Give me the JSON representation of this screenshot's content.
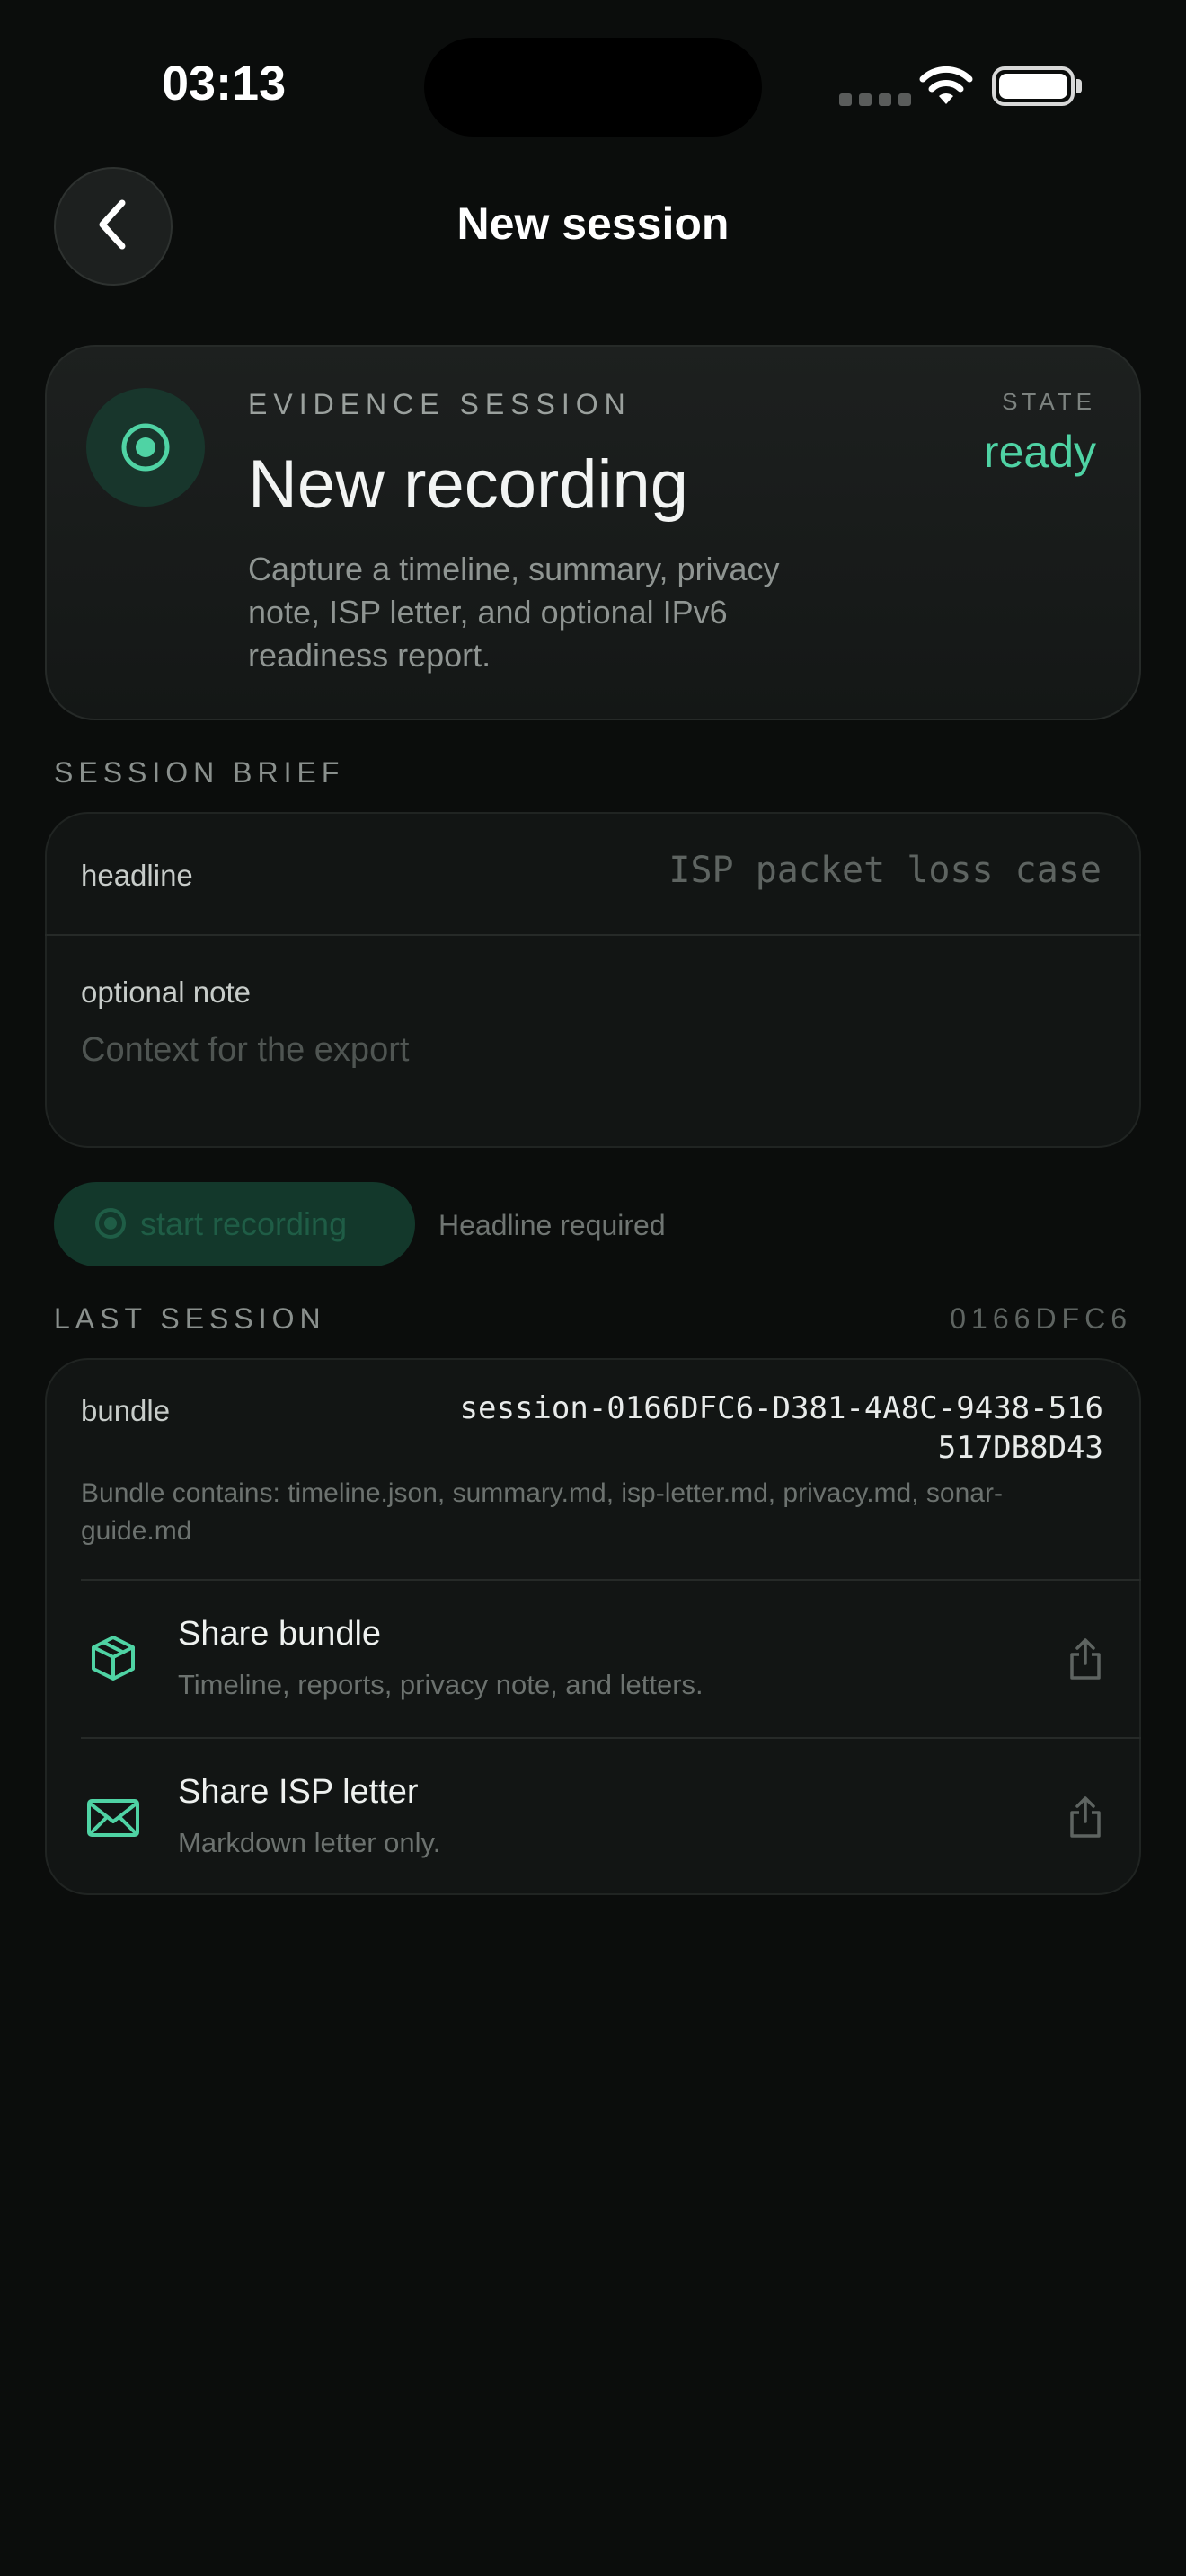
{
  "status_bar": {
    "time": "03:13"
  },
  "nav": {
    "title": "New session"
  },
  "hero": {
    "eyebrow": "EVIDENCE SESSION",
    "title": "New recording",
    "description": "Capture a timeline, summary, privacy note, ISP letter, and optional IPv6 readiness report.",
    "state_label": "STATE",
    "state_value": "ready"
  },
  "brief": {
    "section_title": "SESSION BRIEF",
    "headline_label": "headline",
    "headline_value": "",
    "headline_placeholder": "ISP packet loss case",
    "note_label": "optional note",
    "note_value": "",
    "note_placeholder": "Context for the export"
  },
  "record": {
    "button_label": "start recording",
    "hint": "Headline required"
  },
  "last_session": {
    "section_title": "LAST SESSION",
    "short_id": "0166DFC6",
    "bundle_label": "bundle",
    "bundle_id": "session-0166DFC6-D381-4A8C-9438-516517DB8D43",
    "bundle_contents": "Bundle contains: timeline.json, summary.md, isp-letter.md, privacy.md, sonar-guide.md",
    "actions": [
      {
        "title": "Share bundle",
        "subtitle": "Timeline, reports, privacy note, and letters."
      },
      {
        "title": "Share ISP letter",
        "subtitle": "Markdown letter only."
      }
    ]
  },
  "colors": {
    "accent": "#4fd3a4",
    "background": "#0b0d0c",
    "card": "#121514"
  }
}
